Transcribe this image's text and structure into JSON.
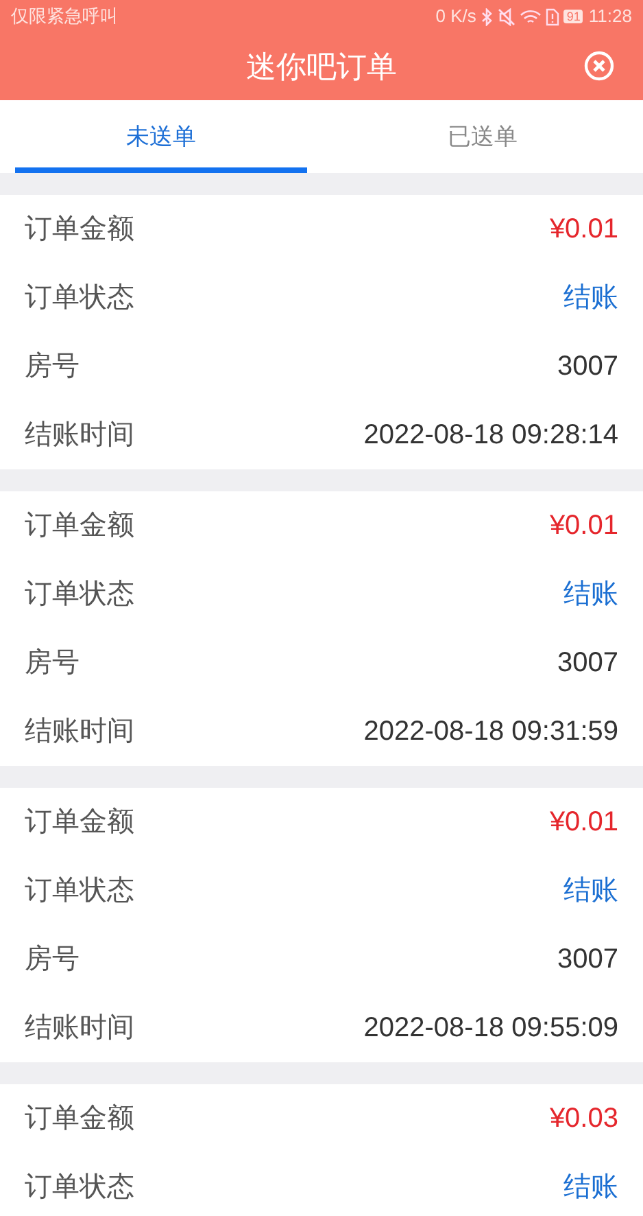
{
  "status_bar": {
    "carrier": "仅限紧急呼叫",
    "speed": "0 K/s",
    "battery": "91",
    "time": "11:28"
  },
  "header": {
    "title": "迷你吧订单"
  },
  "tabs": [
    {
      "label": "未送单",
      "selected": true
    },
    {
      "label": "已送单",
      "selected": false
    }
  ],
  "orders": [
    {
      "rows": [
        {
          "label": "订单金额",
          "value": "¥0.01",
          "kind": "amount"
        },
        {
          "label": "订单状态",
          "value": "结账",
          "kind": "status"
        },
        {
          "label": "房号",
          "value": "3007",
          "kind": "plain"
        },
        {
          "label": "结账时间",
          "value": "2022-08-18 09:28:14",
          "kind": "plain"
        }
      ]
    },
    {
      "rows": [
        {
          "label": "订单金额",
          "value": "¥0.01",
          "kind": "amount"
        },
        {
          "label": "订单状态",
          "value": "结账",
          "kind": "status"
        },
        {
          "label": "房号",
          "value": "3007",
          "kind": "plain"
        },
        {
          "label": "结账时间",
          "value": "2022-08-18 09:31:59",
          "kind": "plain"
        }
      ]
    },
    {
      "rows": [
        {
          "label": "订单金额",
          "value": "¥0.01",
          "kind": "amount"
        },
        {
          "label": "订单状态",
          "value": "结账",
          "kind": "status"
        },
        {
          "label": "房号",
          "value": "3007",
          "kind": "plain"
        },
        {
          "label": "结账时间",
          "value": "2022-08-18 09:55:09",
          "kind": "plain"
        }
      ]
    },
    {
      "rows": [
        {
          "label": "订单金额",
          "value": "¥0.03",
          "kind": "amount"
        },
        {
          "label": "订单状态",
          "value": "结账",
          "kind": "status"
        }
      ]
    }
  ]
}
